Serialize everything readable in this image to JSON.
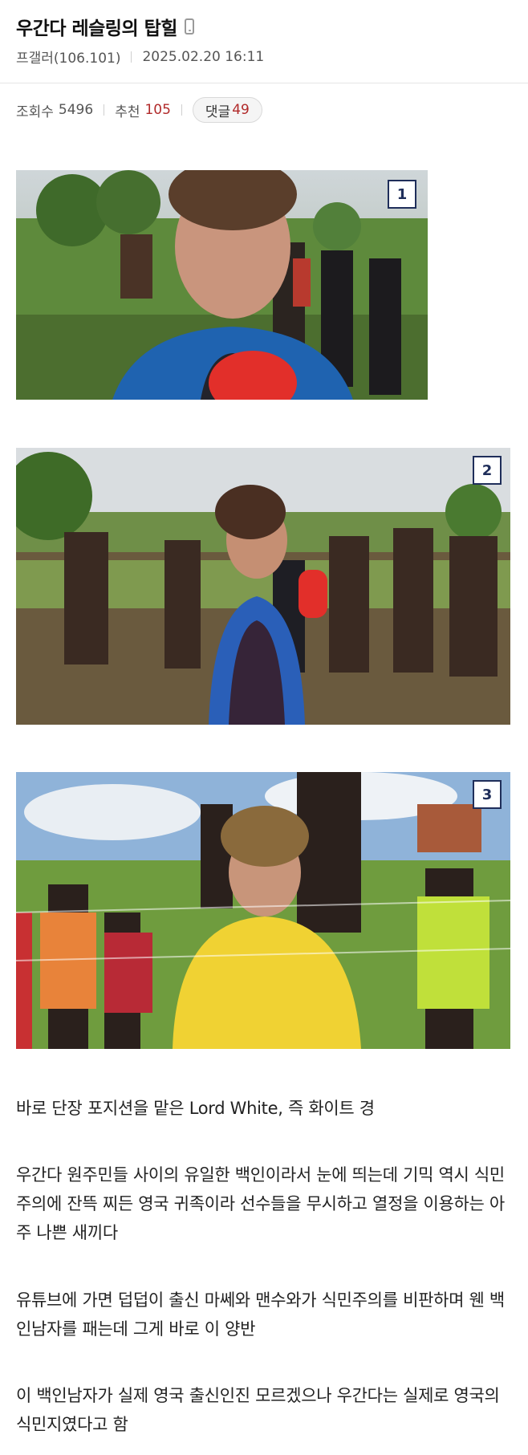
{
  "post": {
    "title": "우간다 레슬링의 탑힐",
    "author": "프갤러(106.101)",
    "datetime": "2025.02.20 16:11",
    "views_label": "조회수",
    "views": "5496",
    "recommend_label": "추천",
    "recommend": "105",
    "comments_label": "댓글",
    "comments": "49"
  },
  "images": [
    {
      "badge": "1"
    },
    {
      "badge": "2"
    },
    {
      "badge": "3"
    }
  ],
  "body": [
    "바로 단장 포지션을 맡은 Lord White, 즉 화이트 경",
    "우간다 원주민들 사이의 유일한 백인이라서 눈에 띄는데 기믹 역시 식민주의에 잔뜩 찌든 영국 귀족이라 선수들을 무시하고 열정을 이용하는 아주 나쁜 새끼다",
    "유튜브에 가면 덥덥이 출신 마쎄와 맨수와가 식민주의를 비판하며 웬 백인남자를 패는데 그게 바로 이 양반",
    "이 백인남자가 실제 영국 출신인진 모르겠으나 우간다는 실제로 영국의 식민지였다고 함"
  ],
  "icons": {
    "title_icon": "mobile-phone-icon"
  },
  "colors": {
    "recommend": "#b12a2a",
    "badge_border": "#1f2e5a"
  }
}
